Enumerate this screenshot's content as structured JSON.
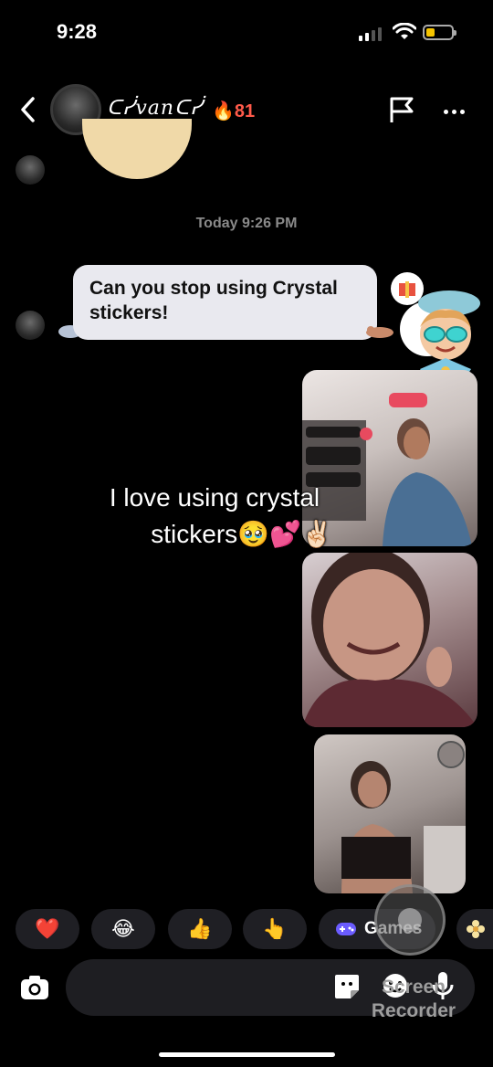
{
  "status_bar": {
    "time": "9:28"
  },
  "header": {
    "username": "ᑕᓰvanᑕᓰ",
    "streak_count": "81",
    "back_icon": "chevron-left-icon",
    "flag_icon": "flag-icon",
    "more_icon": "more-dots-icon"
  },
  "chat": {
    "date_stamp": "Today 9:26 PM",
    "message_text": "Can you stop using Crystal stickers!",
    "overlay_caption_line1": "I love using crystal",
    "overlay_caption_line2": "stickers🥹💕✌🏻"
  },
  "reactions": [
    {
      "emoji": "❤️",
      "name": "heart"
    },
    {
      "emoji": "😂",
      "name": "laugh"
    },
    {
      "emoji": "👍",
      "name": "thumbs-up"
    },
    {
      "emoji": "👆",
      "name": "point-up"
    }
  ],
  "games_label": "Games",
  "input_bar": {
    "camera_icon": "camera-icon",
    "sticker_icon": "sticker-icon",
    "emoji_icon": "emoji-icon",
    "mic_icon": "microphone-icon"
  },
  "watermark": {
    "line1": "Screen",
    "line2": "Recorder"
  },
  "colors": {
    "streak": "#ff5a4a",
    "bubble": "#e9e9ef",
    "battery": "#f5c400",
    "games_icon": "#6b5cff"
  }
}
